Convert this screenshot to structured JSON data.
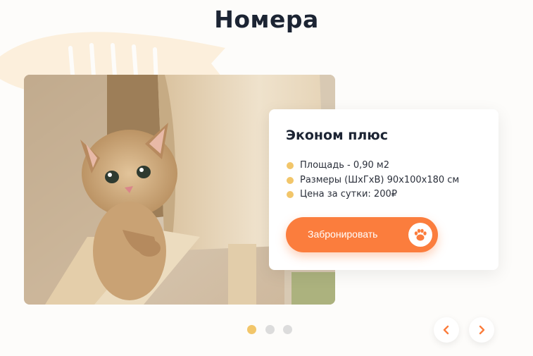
{
  "section": {
    "title": "Номера"
  },
  "room": {
    "name": "Эконом плюс",
    "features": [
      "Площадь - 0,90 м2",
      "Размеры (ШхГхВ) 90х100х180 см",
      "Цена за сутки: 200₽"
    ],
    "book_label": "Забронировать",
    "book_icon": "paw-icon"
  },
  "slider": {
    "total": 3,
    "active_index": 0,
    "prev_icon": "chevron-left-icon",
    "next_icon": "chevron-right-icon"
  },
  "colors": {
    "accent": "#fb7d3d",
    "bullet": "#f2c66a",
    "title": "#1c2433",
    "background": "#fdfcfa"
  }
}
